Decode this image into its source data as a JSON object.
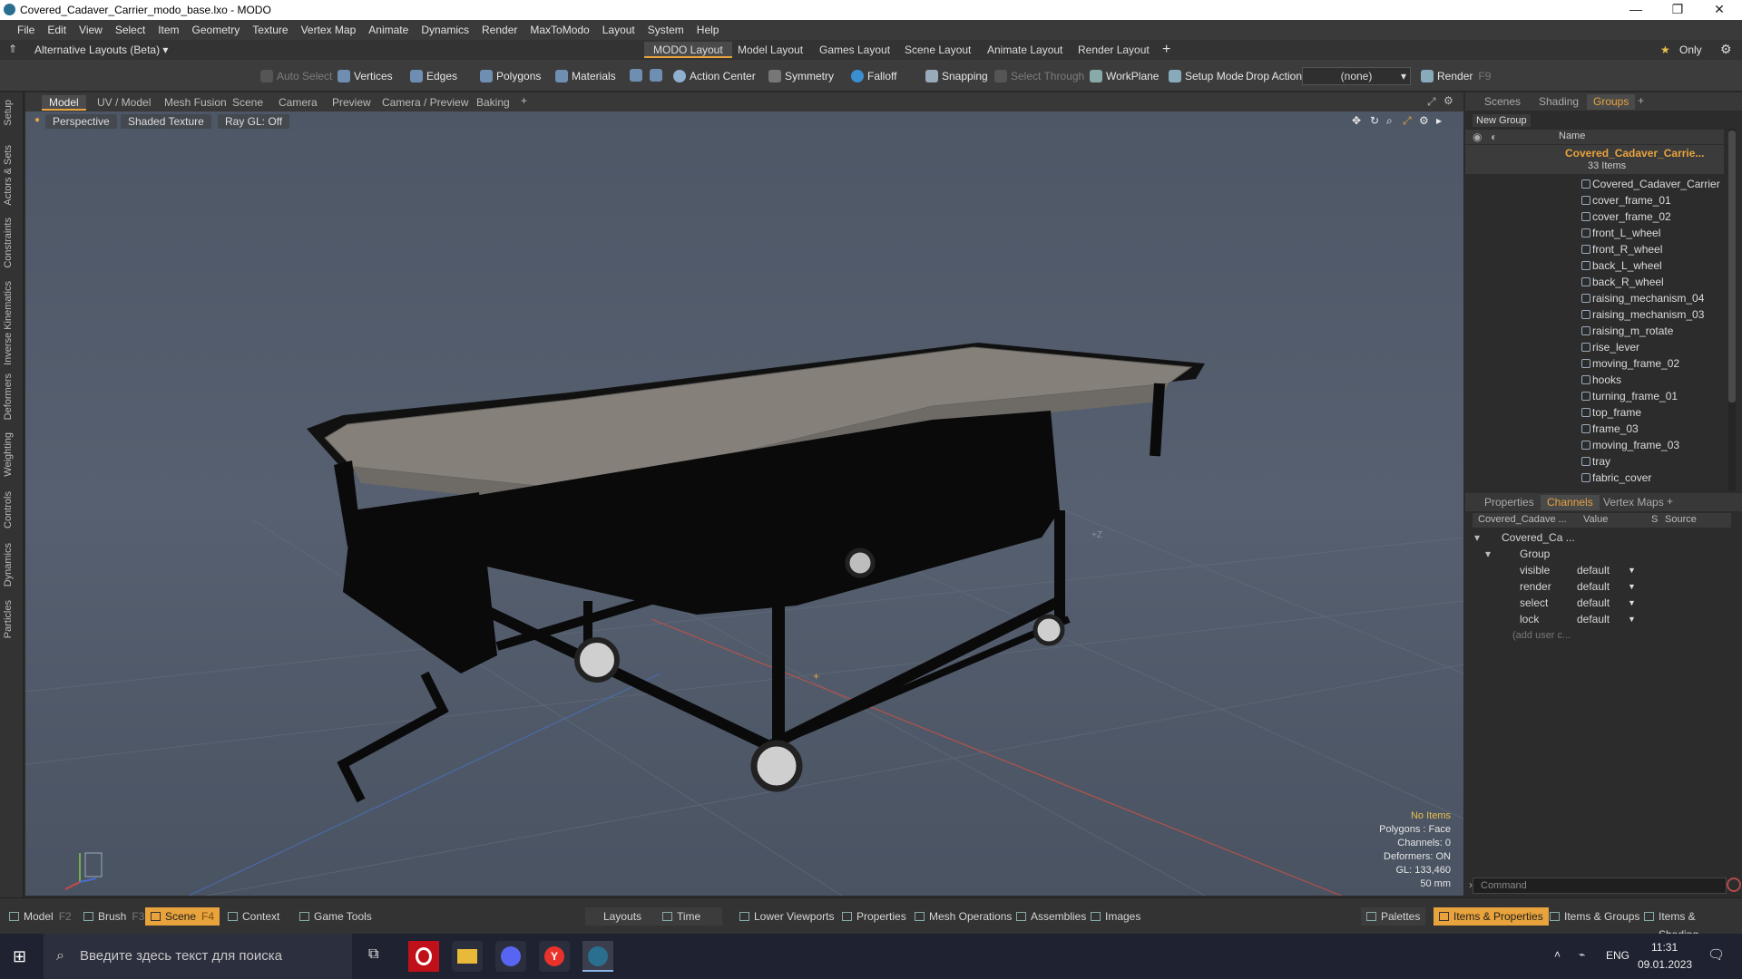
{
  "window": {
    "title": "Covered_Cadaver_Carrier_modo_base.lxo - MODO"
  },
  "menu": [
    "File",
    "Edit",
    "View",
    "Select",
    "Item",
    "Geometry",
    "Texture",
    "Vertex Map",
    "Animate",
    "Dynamics",
    "Render",
    "MaxToModo",
    "Layout",
    "System",
    "Help"
  ],
  "layouts": {
    "selector": "Alternative Layouts (Beta) ▾",
    "tabs": [
      "MODO Layout",
      "Model Layout",
      "Games Layout",
      "Scene Layout",
      "Animate Layout",
      "Render Layout"
    ],
    "active_index": 0,
    "only_label": "Only"
  },
  "toolbar": {
    "auto_select": "Auto Select",
    "vertices": "Vertices",
    "edges": "Edges",
    "polygons": "Polygons",
    "materials": "Materials",
    "action_center": "Action Center",
    "symmetry": "Symmetry",
    "falloff": "Falloff",
    "snapping": "Snapping",
    "select_through": "Select Through",
    "workplane": "WorkPlane",
    "setup_mode": "Setup Mode",
    "drop_action": "Drop Action",
    "drop_value": "(none)",
    "render": "Render",
    "render_key": "F9"
  },
  "viewport_tabs": [
    "Model",
    "UV / Model",
    "Mesh Fusion",
    "Scene",
    "Camera",
    "Preview",
    "Camera / Preview",
    "Baking"
  ],
  "left_tabs": [
    "Setup",
    "Actors & Sets",
    "Constraints",
    "Inverse Kinematics",
    "Deformers",
    "Weighting",
    "Controls",
    "Dynamics",
    "Particles"
  ],
  "viewport": {
    "perspective": "Perspective",
    "shading": "Shaded Texture",
    "raygl": "Ray GL: Off",
    "axis_hint": "+Z",
    "info": {
      "items": "No Items",
      "polygons": "Polygons : Face",
      "channels": "Channels: 0",
      "deformers": "Deformers: ON",
      "gl": "GL: 133,460",
      "scale": "50 mm"
    }
  },
  "scene_panel": {
    "tabs": [
      "Scenes",
      "Shading",
      "Groups"
    ],
    "active": "Groups",
    "new_group": "New Group",
    "col_name": "Name",
    "group_name": "Covered_Cadaver_Carrie...",
    "group_count": "33 Items",
    "items": [
      "Covered_Cadaver_Carrier",
      "cover_frame_01",
      "cover_frame_02",
      "front_L_wheel",
      "front_R_wheel",
      "back_L_wheel",
      "back_R_wheel",
      "raising_mechanism_04",
      "raising_mechanism_03",
      "raising_m_rotate",
      "rise_lever",
      "moving_frame_02",
      "hooks",
      "turning_frame_01",
      "top_frame",
      "frame_03",
      "moving_frame_03",
      "tray",
      "fabric_cover"
    ]
  },
  "props_panel": {
    "tabs": [
      "Properties",
      "Channels",
      "Vertex Maps"
    ],
    "active": "Channels",
    "col1": "Covered_Cadave ...",
    "col2": "Value",
    "col3": "S",
    "col4": "Source",
    "root": "Covered_Ca ...",
    "group": "Group",
    "rows": [
      {
        "name": "visible",
        "value": "default"
      },
      {
        "name": "render",
        "value": "default"
      },
      {
        "name": "select",
        "value": "default"
      },
      {
        "name": "lock",
        "value": "default"
      }
    ],
    "add_user": "(add user c...",
    "command_placeholder": "Command"
  },
  "bottom_bar": {
    "model": "Model",
    "model_key": "F2",
    "brush": "Brush",
    "brush_key": "F3",
    "scene": "Scene",
    "scene_key": "F4",
    "context": "Context",
    "game_tools": "Game Tools",
    "layouts": "Layouts",
    "time": "Time",
    "lower_viewports": "Lower Viewports",
    "properties": "Properties",
    "mesh_operations": "Mesh Operations",
    "assemblies": "Assemblies",
    "images": "Images",
    "palettes": "Palettes",
    "items_properties": "Items & Properties",
    "items_groups": "Items & Groups",
    "items_shading": "Items & Shading"
  },
  "taskbar": {
    "search_placeholder": "Введите здесь текст для поиска",
    "lang": "ENG",
    "time": "11:31",
    "date": "09.01.2023"
  },
  "colors": {
    "accent": "#e8a33d",
    "viewport_bg": "#525b6a",
    "panel_bg": "#2c2c2c"
  }
}
